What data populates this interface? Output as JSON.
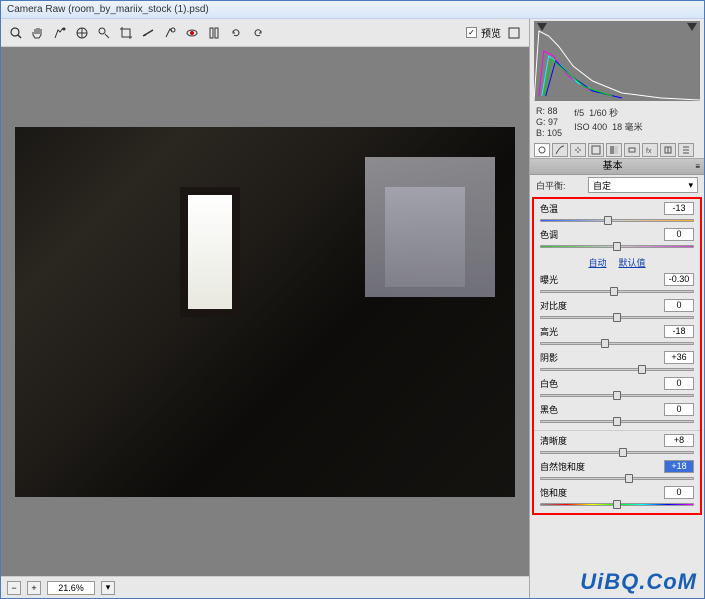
{
  "title": "Camera Raw (room_by_mariix_stock (1).psd)",
  "preview_label": "预览",
  "zoom": "21.6%",
  "metadata": {
    "r_label": "R:",
    "r": "88",
    "g_label": "G:",
    "g": "97",
    "b_label": "B:",
    "b": "105",
    "aperture": "f/5",
    "shutter": "1/60 秒",
    "iso_label": "ISO",
    "iso": "400",
    "focal": "18 毫米"
  },
  "panel_title": "基本",
  "wb_label": "白平衡:",
  "wb_value": "自定",
  "auto_link": "自动",
  "default_link": "默认值",
  "sliders": {
    "temp": {
      "label": "色温",
      "value": "-13",
      "pos": 44
    },
    "tint": {
      "label": "色调",
      "value": "0",
      "pos": 50
    },
    "exposure": {
      "label": "曝光",
      "value": "-0.30",
      "pos": 48
    },
    "contrast": {
      "label": "对比度",
      "value": "0",
      "pos": 50
    },
    "highlights": {
      "label": "高光",
      "value": "-18",
      "pos": 42
    },
    "shadows": {
      "label": "阴影",
      "value": "+36",
      "pos": 66
    },
    "whites": {
      "label": "白色",
      "value": "0",
      "pos": 50
    },
    "blacks": {
      "label": "黑色",
      "value": "0",
      "pos": 50
    },
    "clarity": {
      "label": "清晰度",
      "value": "+8",
      "pos": 54
    },
    "vibrance": {
      "label": "自然饱和度",
      "value": "+18",
      "pos": 58
    },
    "saturation": {
      "label": "饱和度",
      "value": "0",
      "pos": 50
    }
  },
  "watermark": "UiBQ.CoM"
}
